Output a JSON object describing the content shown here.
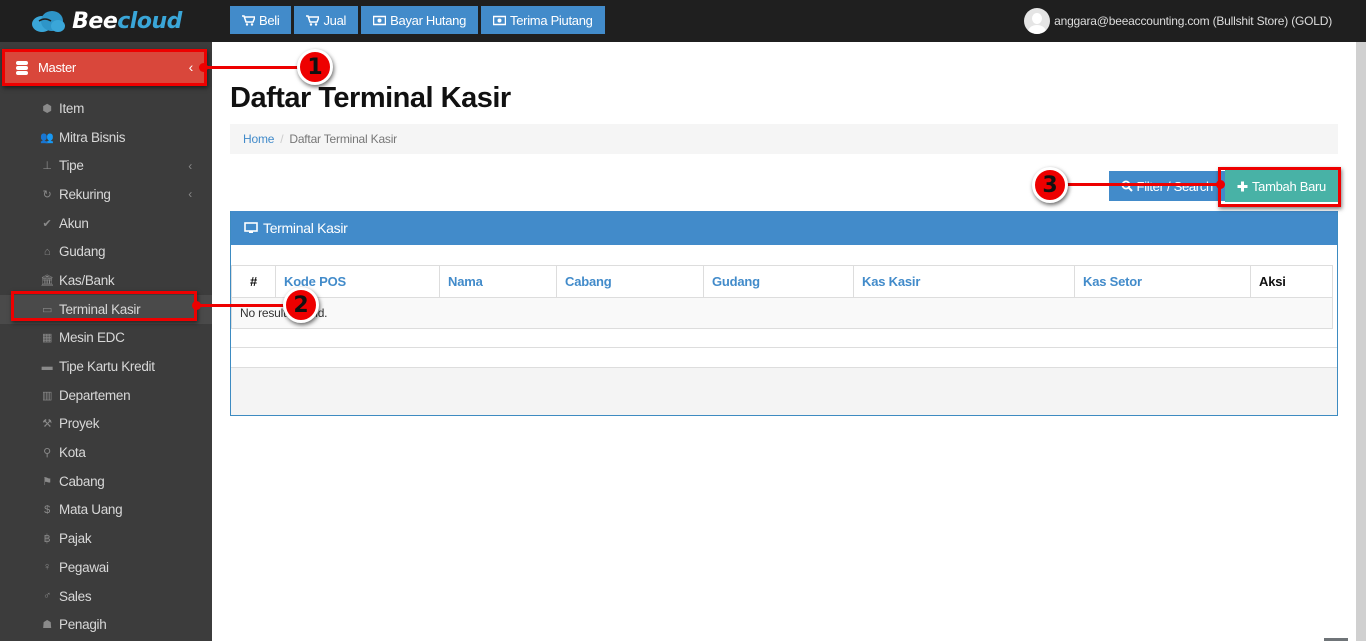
{
  "app": {
    "logo_text_1": "Bee",
    "logo_text_2": "cloud",
    "user_label": "anggara@beeaccounting.com (Bullshit Store) (GOLD)"
  },
  "topnav": [
    {
      "label": "Beli",
      "icon": "cart-icon"
    },
    {
      "label": "Jual",
      "icon": "cart-icon"
    },
    {
      "label": "Bayar Hutang",
      "icon": "money-icon"
    },
    {
      "label": "Terima Piutang",
      "icon": "money-icon"
    }
  ],
  "sidebar": {
    "section_label": "Master",
    "items": [
      {
        "label": "Item",
        "icon": "cube-icon",
        "glyph": "⬢"
      },
      {
        "label": "Mitra Bisnis",
        "icon": "users-icon",
        "glyph": "👥"
      },
      {
        "label": "Tipe",
        "icon": "sitemap-icon",
        "glyph": "⊥",
        "has_sub": true
      },
      {
        "label": "Rekuring",
        "icon": "repeat-icon",
        "glyph": "↻",
        "has_sub": true
      },
      {
        "label": "Akun",
        "icon": "check-icon",
        "glyph": "✔"
      },
      {
        "label": "Gudang",
        "icon": "home-icon",
        "glyph": "⌂"
      },
      {
        "label": "Kas/Bank",
        "icon": "bank-icon",
        "glyph": "🏛"
      },
      {
        "label": "Terminal Kasir",
        "icon": "desktop-icon",
        "glyph": "▭",
        "active": true
      },
      {
        "label": "Mesin EDC",
        "icon": "calculator-icon",
        "glyph": "▦"
      },
      {
        "label": "Tipe Kartu Kredit",
        "icon": "credit-card-icon",
        "glyph": "▬"
      },
      {
        "label": "Departemen",
        "icon": "building-icon",
        "glyph": "▥"
      },
      {
        "label": "Proyek",
        "icon": "gavel-icon",
        "glyph": "⚒"
      },
      {
        "label": "Kota",
        "icon": "map-marker-icon",
        "glyph": "⚲"
      },
      {
        "label": "Cabang",
        "icon": "flag-icon",
        "glyph": "⚑"
      },
      {
        "label": "Mata Uang",
        "icon": "dollar-icon",
        "glyph": "$"
      },
      {
        "label": "Pajak",
        "icon": "bitcoin-icon",
        "glyph": "฿"
      },
      {
        "label": "Pegawai",
        "icon": "female-icon",
        "glyph": "♀"
      },
      {
        "label": "Sales",
        "icon": "male-icon",
        "glyph": "♂"
      },
      {
        "label": "Penagih",
        "icon": "user-md-icon",
        "glyph": "☗"
      }
    ]
  },
  "page": {
    "title": "Daftar Terminal Kasir",
    "breadcrumb_home": "Home",
    "breadcrumb_sep": "/",
    "breadcrumb_current": "Daftar Terminal Kasir",
    "filter_button": "Filter / Search",
    "add_button": "Tambah Baru"
  },
  "panel": {
    "title": "Terminal Kasir",
    "columns": [
      "#",
      "Kode POS",
      "Nama",
      "Cabang",
      "Gudang",
      "Kas Kasir",
      "Kas Setor",
      "Aksi"
    ],
    "empty_text": "No results found."
  },
  "annotations": [
    "1",
    "2",
    "3"
  ],
  "colors": {
    "primary": "#428bca",
    "success": "#48b2a6",
    "danger": "#d9473b",
    "annotation": "#ee0000"
  }
}
